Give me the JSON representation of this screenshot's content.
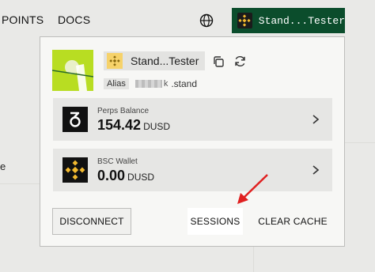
{
  "nav": {
    "points_label": "POINTS",
    "docs_label": "DOCS",
    "wallet_button_label": "Stand...Tester"
  },
  "side": {
    "text": "e"
  },
  "account": {
    "display_name": "Stand...Tester",
    "alias_tag": "Alias",
    "alias_suffix": ".stand"
  },
  "cards": [
    {
      "label": "Perps Balance",
      "value": "154.42",
      "unit": "DUSD",
      "icon": "perps-logo-icon"
    },
    {
      "label": "BSC Wallet",
      "value": "0.00",
      "unit": "DUSD",
      "icon": "bnb-icon"
    }
  ],
  "actions": {
    "disconnect": "DISCONNECT",
    "sessions": "SESSIONS",
    "clear_cache": "CLEAR CACHE"
  },
  "colors": {
    "wallet_button_bg": "#0b4d2c",
    "avatar_bg": "#b8dd22",
    "bnb_yellow": "#f3ba2f",
    "annotation_arrow": "#e02020"
  }
}
